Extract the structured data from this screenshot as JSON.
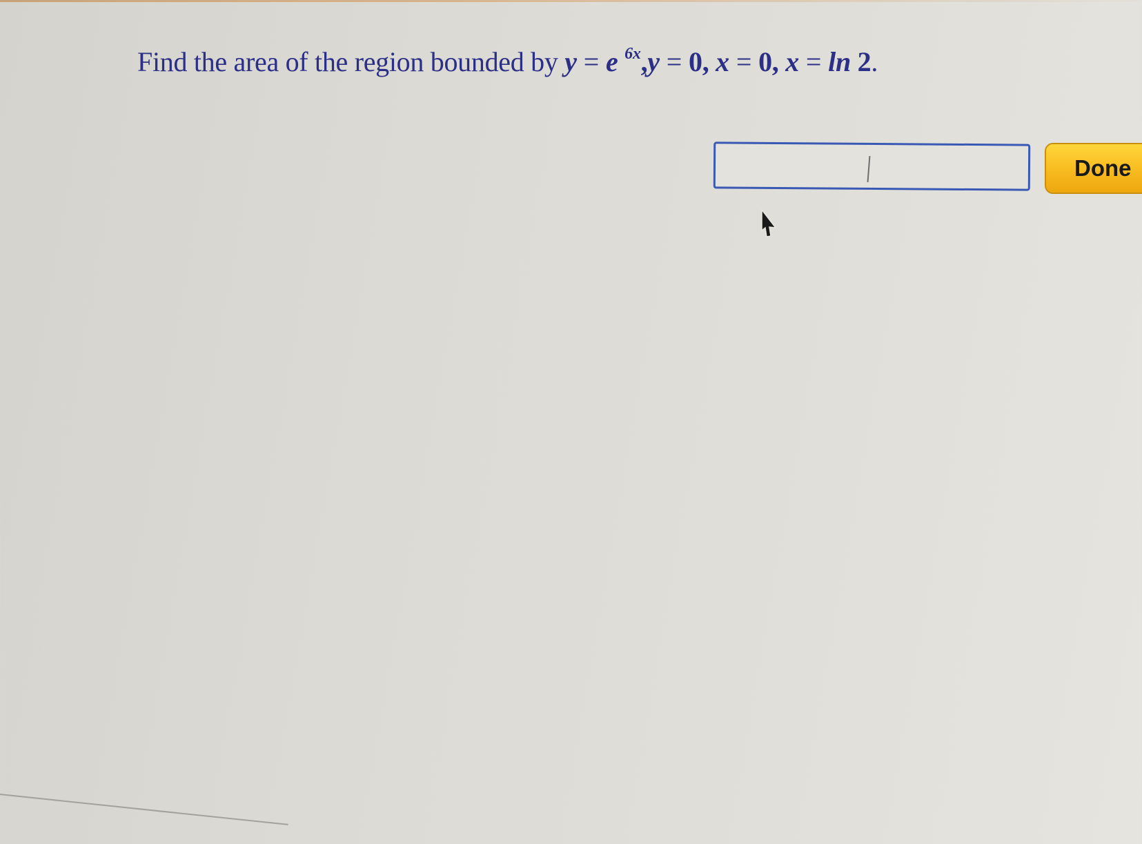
{
  "question": {
    "prefix": "Find the area of the region bounded by ",
    "y1": "y",
    "eq1": "=",
    "base": "e",
    "exponent": "6x",
    "sep1": ",",
    "y2": "y",
    "eq2": "=",
    "zero1": "0",
    "sep2": ",",
    "x1": "x",
    "eq3": "=",
    "zero2": "0",
    "sep3": ",",
    "x2": "x",
    "eq4": "=",
    "ln": "ln",
    "two": "2",
    "end": "."
  },
  "answer": {
    "value": ""
  },
  "done_label": "Done",
  "colors": {
    "question_text": "#2b2f86",
    "field_border": "#3a59b5",
    "done_button": "#f7bb1f"
  },
  "icons": {
    "cursor": "cursor-arrow-icon"
  }
}
